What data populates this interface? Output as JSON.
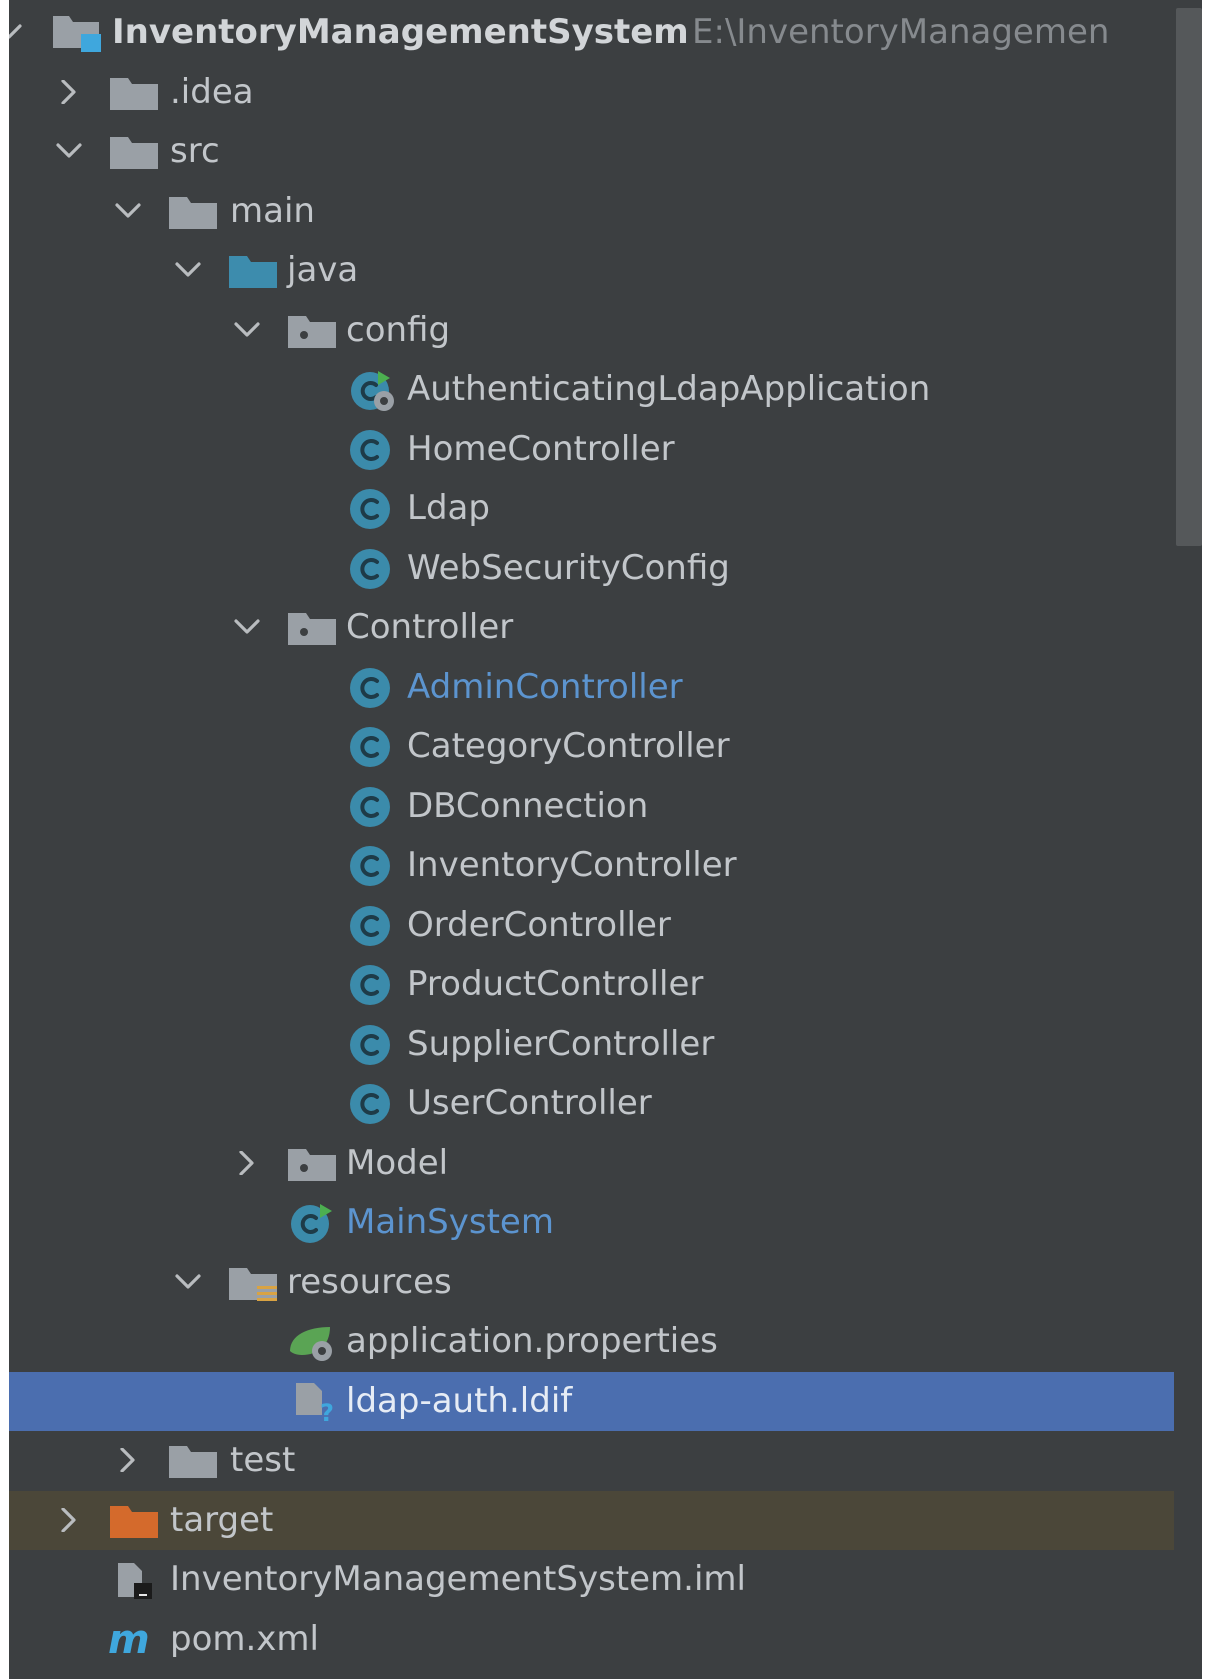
{
  "colors": {
    "background": "#3c3f41",
    "selection": "#4b6eaf",
    "excluded": "#4b4739",
    "text": "#c2c6ca",
    "path_text": "#868a8e",
    "modified_text": "#5c94cf",
    "class_icon": "#3b8bab",
    "folder_gray": "#9aa0a6",
    "folder_source": "#3d8cad",
    "folder_excluded": "#d46a2c"
  },
  "tree": {
    "root": {
      "label": "InventoryManagementSystem",
      "path": "E:\\InventoryManagemen",
      "icon": "module-folder-icon"
    },
    "idea": {
      "label": ".idea",
      "icon": "folder-icon"
    },
    "src": {
      "label": "src",
      "icon": "folder-icon"
    },
    "main": {
      "label": "main",
      "icon": "folder-icon"
    },
    "java": {
      "label": "java",
      "icon": "source-folder-icon"
    },
    "config": {
      "label": "config",
      "icon": "package-icon"
    },
    "config_items": [
      {
        "label": "AuthenticatingLdapApplication",
        "icon": "spring-boot-class-icon"
      },
      {
        "label": "HomeController",
        "icon": "class-icon"
      },
      {
        "label": "Ldap",
        "icon": "class-icon"
      },
      {
        "label": "WebSecurityConfig",
        "icon": "class-icon"
      }
    ],
    "controller": {
      "label": "Controller",
      "icon": "package-icon"
    },
    "controller_items": [
      {
        "label": "AdminController",
        "icon": "class-icon",
        "modified": true
      },
      {
        "label": "CategoryController",
        "icon": "class-icon"
      },
      {
        "label": "DBConnection",
        "icon": "class-icon"
      },
      {
        "label": "InventoryController",
        "icon": "class-icon"
      },
      {
        "label": "OrderController",
        "icon": "class-icon"
      },
      {
        "label": "ProductController",
        "icon": "class-icon"
      },
      {
        "label": "SupplierController",
        "icon": "class-icon"
      },
      {
        "label": "UserController",
        "icon": "class-icon"
      }
    ],
    "model": {
      "label": "Model",
      "icon": "package-icon"
    },
    "mainsystem": {
      "label": "MainSystem",
      "icon": "runnable-class-icon"
    },
    "resources": {
      "label": "resources",
      "icon": "resources-folder-icon"
    },
    "app_props": {
      "label": "application.properties",
      "icon": "spring-properties-icon"
    },
    "ldif": {
      "label": "ldap-auth.ldif",
      "icon": "unknown-file-icon"
    },
    "test": {
      "label": "test",
      "icon": "folder-icon"
    },
    "target": {
      "label": "target",
      "icon": "excluded-folder-icon"
    },
    "iml": {
      "label": "InventoryManagementSystem.iml",
      "icon": "iml-file-icon"
    },
    "pom": {
      "label": "pom.xml",
      "icon": "maven-icon"
    }
  }
}
